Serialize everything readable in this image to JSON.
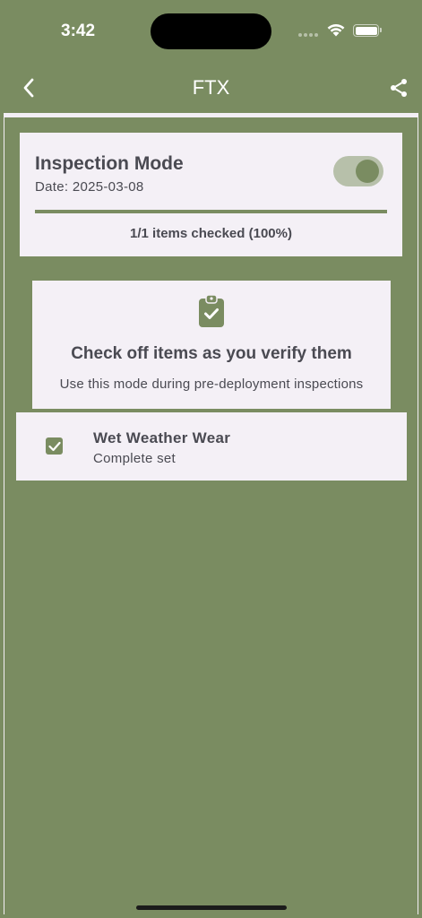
{
  "status_bar": {
    "time": "3:42"
  },
  "nav": {
    "title": "FTX",
    "back_icon": "chevron-left-icon",
    "share_icon": "share-icon"
  },
  "inspection": {
    "title": "Inspection Mode",
    "date": "Date: 2025-03-08",
    "toggle_on": true,
    "progress_fraction": 1.0,
    "progress_text": "1/1 items checked (100%)"
  },
  "info": {
    "icon": "clipboard-check-icon",
    "heading": "Check off items as you verify them",
    "subtext": "Use this mode during pre-deployment inspections"
  },
  "items": [
    {
      "name": "Wet Weather Wear",
      "description": "Complete set",
      "checked": true
    }
  ],
  "colors": {
    "accent": "#7a8c61",
    "card": "#f4f0f6",
    "text": "#4a4a52"
  }
}
